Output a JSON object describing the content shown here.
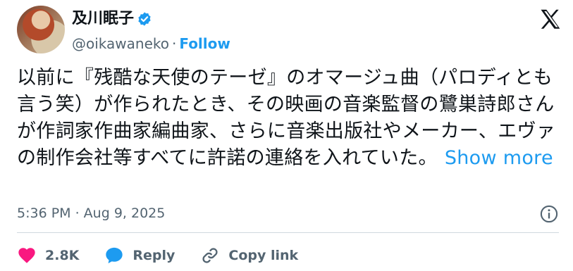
{
  "user": {
    "display_name": "及川眠子",
    "handle": "@oikawaneko",
    "separator": "·",
    "follow_label": "Follow"
  },
  "tweet": {
    "text": "以前に『残酷な天使のテーゼ』のオマージュ曲（パロディとも言う笑）が作られたとき、その映画の音楽監督の鷺巣詩郎さんが作詞家作曲家編曲家、さらに音楽出版社やメーカー、エヴァの制作会社等すべてに許諾の連絡を入れていた。",
    "show_more_label": "Show more",
    "timestamp": "5:36 PM · Aug 9, 2025"
  },
  "actions": {
    "like_count": "2.8K",
    "reply_label": "Reply",
    "copy_link_label": "Copy link"
  },
  "colors": {
    "accent": "#1d9bf0",
    "like": "#f91880",
    "muted": "#536471"
  },
  "icons": {
    "verified": "verified-badge-icon",
    "brand": "x-logo-icon",
    "info": "info-icon",
    "like": "heart-icon",
    "reply": "speech-bubble-icon",
    "copy_link": "link-icon"
  }
}
